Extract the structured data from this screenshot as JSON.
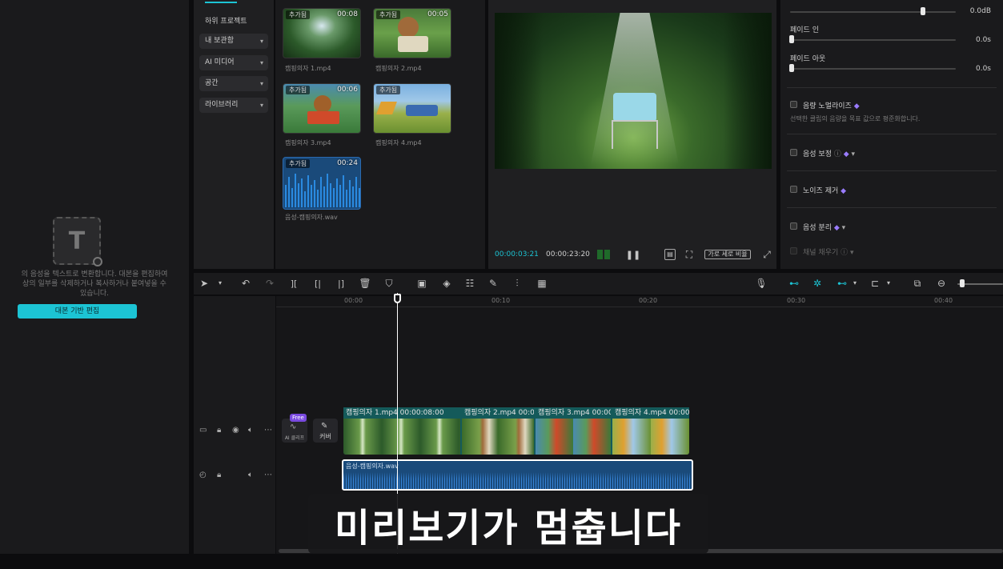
{
  "left_panel": {
    "script_text_line1": "의 음성을 텍스트로 변환합니다. 대본을 편집하여",
    "script_text_line2": "상의 일부를 삭제하거나 복사하거나 붙여넣을 수",
    "script_text_line3": "있습니다.",
    "script_edit_button": "대본 기반 편집"
  },
  "media_nav": {
    "items": [
      {
        "label": "하위 프로젝트"
      },
      {
        "label": "내 보관함"
      },
      {
        "label": "AI 미디어"
      },
      {
        "label": "공간"
      },
      {
        "label": "라이브러리"
      }
    ]
  },
  "media_grid": {
    "items": [
      {
        "tag": "추가됨",
        "duration": "00:08",
        "name": "캠핑의자 1.mp4"
      },
      {
        "tag": "추가됨",
        "duration": "00:05",
        "name": "캠핑의자 2.mp4"
      },
      {
        "tag": "추가됨",
        "duration": "00:06",
        "name": "캠핑의자 3.mp4"
      },
      {
        "tag": "추가됨",
        "duration": "",
        "name": "캠핑의자 4.mp4"
      },
      {
        "tag": "추가됨",
        "duration": "00:24",
        "name": "음성-캠핑의자.wav"
      }
    ]
  },
  "preview": {
    "current_time": "00:00:03:21",
    "total_time": "00:00:23:20",
    "ratio_label": "가로 세로 비율"
  },
  "audio_props": {
    "volume_value": "0.0dB",
    "volume_level": 0.8,
    "fade_in_label": "페이드 인",
    "fade_in_value": "0.0s",
    "fade_out_label": "페이드 아웃",
    "fade_out_value": "0.0s",
    "normalize_label": "음량 노멀라이즈",
    "normalize_desc": "선택한 클립의 음량을 목표 값으로 평준화합니다.",
    "voice_enhance_label": "음성 보정",
    "noise_reduce_label": "노이즈 제거",
    "voice_separate_label": "음성 분리",
    "blank_fill_label": "채널 채우기"
  },
  "timeline": {
    "ruler": [
      "00:00",
      "00:10",
      "00:20",
      "00:30",
      "00:40"
    ],
    "video_clips": [
      {
        "label": "캠핑의자 1.mp4",
        "duration": "00:00:08:00"
      },
      {
        "label": "캠핑의자 2.mp4",
        "duration": "00:0"
      },
      {
        "label": "캠핑의자 3.mp4",
        "duration": "00:00"
      },
      {
        "label": "캠핑의자 4.mp4",
        "duration": "00:00"
      }
    ],
    "audio_clip_label": "음성-캠핑의자.wav",
    "free_badge": "Free",
    "ai_label": "AI 클리프",
    "cover_label": "커버"
  },
  "subtitle": "미리보기가 멈춥니다",
  "colors": {
    "accent": "#1cc4d4",
    "clip_teal": "#145a5a",
    "audio_blue": "#1a4a7a",
    "gem": "#9a7cff"
  }
}
